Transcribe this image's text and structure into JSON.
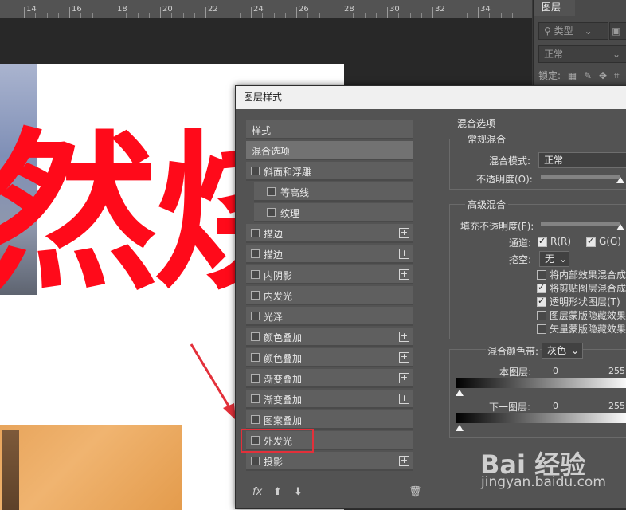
{
  "ruler": {
    "numbers": [
      "14",
      "16",
      "18",
      "20",
      "22",
      "24",
      "26",
      "28",
      "30",
      "32",
      "34"
    ]
  },
  "canvas": {
    "big_text": "然烧"
  },
  "layers_panel": {
    "tab_label": "图层",
    "filter_label": "类型",
    "blend_mode": "正常",
    "lock_label": "锁定:"
  },
  "dialog": {
    "title": "图层样式",
    "styles": [
      {
        "label": "样式",
        "checkbox": false,
        "indent": false,
        "plus": false,
        "selected": false
      },
      {
        "label": "混合选项",
        "checkbox": false,
        "indent": false,
        "plus": false,
        "selected": true
      },
      {
        "label": "斜面和浮雕",
        "checkbox": true,
        "indent": false,
        "plus": false,
        "selected": false
      },
      {
        "label": "等高线",
        "checkbox": true,
        "indent": true,
        "plus": false,
        "selected": false
      },
      {
        "label": "纹理",
        "checkbox": true,
        "indent": true,
        "plus": false,
        "selected": false
      },
      {
        "label": "描边",
        "checkbox": true,
        "indent": false,
        "plus": true,
        "selected": false
      },
      {
        "label": "描边",
        "checkbox": true,
        "indent": false,
        "plus": true,
        "selected": false
      },
      {
        "label": "内阴影",
        "checkbox": true,
        "indent": false,
        "plus": true,
        "selected": false
      },
      {
        "label": "内发光",
        "checkbox": true,
        "indent": false,
        "plus": false,
        "selected": false
      },
      {
        "label": "光泽",
        "checkbox": true,
        "indent": false,
        "plus": false,
        "selected": false
      },
      {
        "label": "颜色叠加",
        "checkbox": true,
        "indent": false,
        "plus": true,
        "selected": false
      },
      {
        "label": "颜色叠加",
        "checkbox": true,
        "indent": false,
        "plus": true,
        "selected": false
      },
      {
        "label": "渐变叠加",
        "checkbox": true,
        "indent": false,
        "plus": true,
        "selected": false
      },
      {
        "label": "渐变叠加",
        "checkbox": true,
        "indent": false,
        "plus": true,
        "selected": false
      },
      {
        "label": "图案叠加",
        "checkbox": true,
        "indent": false,
        "plus": false,
        "selected": false
      },
      {
        "label": "外发光",
        "checkbox": true,
        "indent": false,
        "plus": false,
        "selected": false
      },
      {
        "label": "投影",
        "checkbox": true,
        "indent": false,
        "plus": true,
        "selected": false
      }
    ],
    "fx_label": "fx",
    "options": {
      "section_title": "混合选项",
      "general_title": "常规混合",
      "blend_mode_label": "混合模式:",
      "blend_mode_value": "正常",
      "opacity_label": "不透明度(O):",
      "opacity_value": 1.0,
      "advanced_title": "高级混合",
      "fill_opacity_label": "填充不透明度(F):",
      "fill_opacity_value": 1.0,
      "channels_label": "通道:",
      "channel_r": "R(R)",
      "channel_g": "G(G)",
      "knockout_label": "挖空:",
      "knockout_value": "无",
      "checkboxes": [
        {
          "label": "将内部效果混合成",
          "checked": false
        },
        {
          "label": "将剪贴图层混合成",
          "checked": true
        },
        {
          "label": "透明形状图层(T)",
          "checked": true
        },
        {
          "label": "图层蒙版隐藏效果",
          "checked": false
        },
        {
          "label": "矢量蒙版隐藏效果",
          "checked": false
        }
      ],
      "blend_if_label": "混合颜色带:",
      "blend_if_value": "灰色",
      "this_layer_label": "本图层:",
      "this_layer_min": "0",
      "this_layer_max": "255",
      "underlying_label": "下一图层:",
      "underlying_min": "0",
      "underlying_max": "255"
    }
  },
  "watermark": {
    "logo": "Bai 经验",
    "url": "jingyan.baidu.com"
  },
  "colors": {
    "accent_red": "#ff0a1a",
    "highlight_box": "#e3303a",
    "dialog_bg": "#535353"
  }
}
